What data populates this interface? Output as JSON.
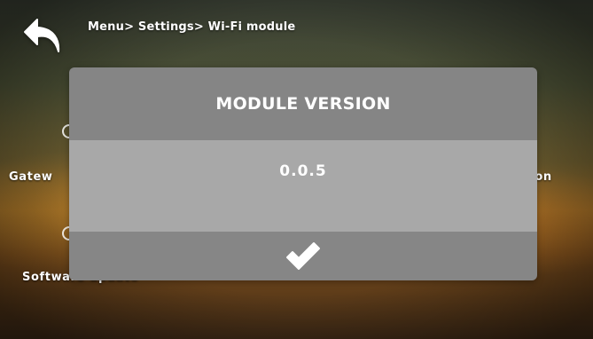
{
  "header": {
    "breadcrumb": "Menu> Settings> Wi-Fi module",
    "back_icon": "back-arrow-icon"
  },
  "background_menu": {
    "left_item": "Gatew",
    "right_item": "rsion",
    "bottom_item": "Software update"
  },
  "dialog": {
    "title": "MODULE VERSION",
    "value": "0.0.5",
    "confirm_icon": "checkmark-icon"
  },
  "colors": {
    "dialog_header": "#858585",
    "dialog_body": "#a8a8a8",
    "dialog_footer": "#868686",
    "text": "#ffffff"
  }
}
